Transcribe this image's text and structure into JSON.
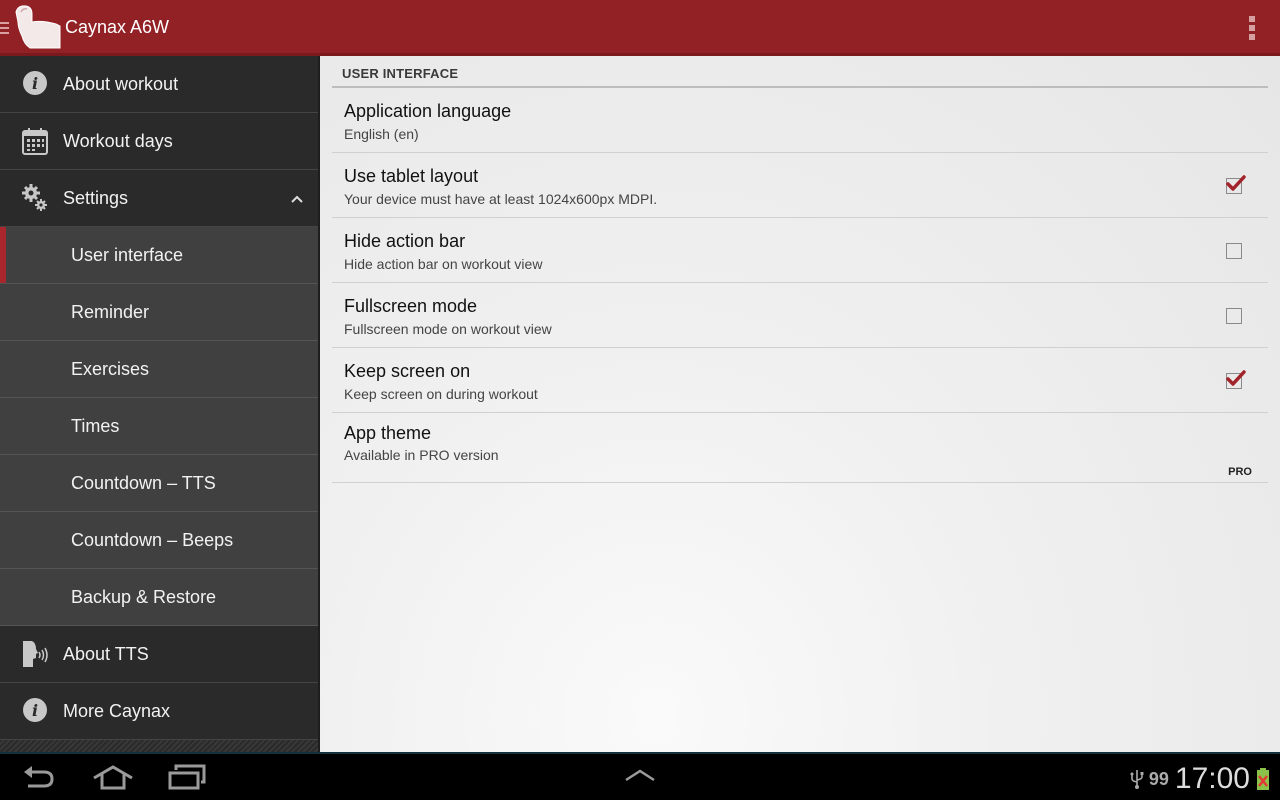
{
  "actionbar": {
    "title": "Caynax A6W",
    "accent_color": "#922126"
  },
  "sidebar": {
    "items": [
      {
        "label": "About workout",
        "icon": "info-icon",
        "level": "top"
      },
      {
        "label": "Workout days",
        "icon": "calendar-icon",
        "level": "top"
      },
      {
        "label": "Settings",
        "icon": "gears-icon",
        "level": "top",
        "expanded": true
      },
      {
        "label": "User interface",
        "level": "sub",
        "active": true
      },
      {
        "label": "Reminder",
        "level": "sub"
      },
      {
        "label": "Exercises",
        "level": "sub"
      },
      {
        "label": "Times",
        "level": "sub"
      },
      {
        "label": "Countdown – TTS",
        "level": "sub"
      },
      {
        "label": "Countdown – Beeps",
        "level": "sub"
      },
      {
        "label": "Backup & Restore",
        "level": "sub"
      },
      {
        "label": "About TTS",
        "icon": "speaking-head-icon",
        "level": "top"
      },
      {
        "label": "More Caynax",
        "icon": "info-icon",
        "level": "top"
      }
    ]
  },
  "content": {
    "section_header": "USER INTERFACE",
    "preferences": [
      {
        "title": "Application language",
        "summary": "English (en)"
      },
      {
        "title": "Use tablet layout",
        "summary": "Your device must have at least 1024x600px MDPI.",
        "checked": true
      },
      {
        "title": "Hide action bar",
        "summary": "Hide action bar on workout view",
        "checked": false
      },
      {
        "title": "Fullscreen mode",
        "summary": "Fullscreen mode on workout view",
        "checked": false
      },
      {
        "title": "Keep screen on",
        "summary": "Keep screen on during workout",
        "checked": true
      },
      {
        "title": "App theme",
        "summary": "Available in PRO version",
        "badge": "PRO"
      }
    ]
  },
  "system_bar": {
    "battery_level": "99",
    "clock": "17:00"
  }
}
